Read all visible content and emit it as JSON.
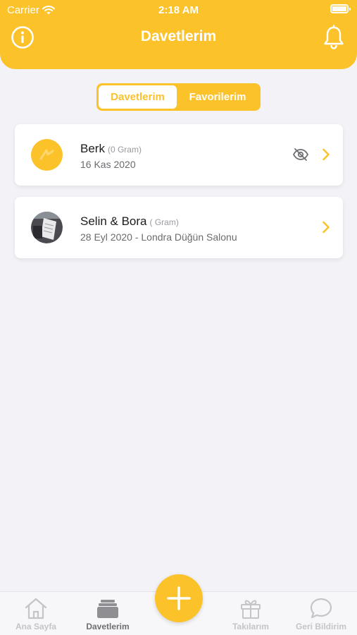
{
  "status_bar": {
    "carrier": "Carrier",
    "time": "2:18 AM"
  },
  "header": {
    "title": "Davetlerim"
  },
  "segment": {
    "tabs": [
      {
        "label": "Davetlerim",
        "active": true
      },
      {
        "label": "Favorilerim",
        "active": false
      }
    ]
  },
  "invitations": [
    {
      "name": "Berk",
      "gram": "(0 Gram)",
      "subtitle": "16 Kas 2020",
      "hidden_icon": "eye-slash-icon"
    },
    {
      "name": "Selin & Bora",
      "gram": "( Gram)",
      "subtitle": "28 Eyl 2020 - Londra Düğün Salonu"
    }
  ],
  "tabbar": {
    "items": [
      {
        "label": "Ana Sayfa",
        "icon": "home-icon"
      },
      {
        "label": "Davetlerim",
        "icon": "invitations-icon",
        "active": true
      },
      {
        "label": "Takılarım",
        "icon": "gift-icon"
      },
      {
        "label": "Geri Bildirim",
        "icon": "chat-bubble-icon"
      }
    ],
    "fab_icon": "plus-icon"
  },
  "colors": {
    "accent": "#fcc22a",
    "background": "#f2f2f7"
  }
}
